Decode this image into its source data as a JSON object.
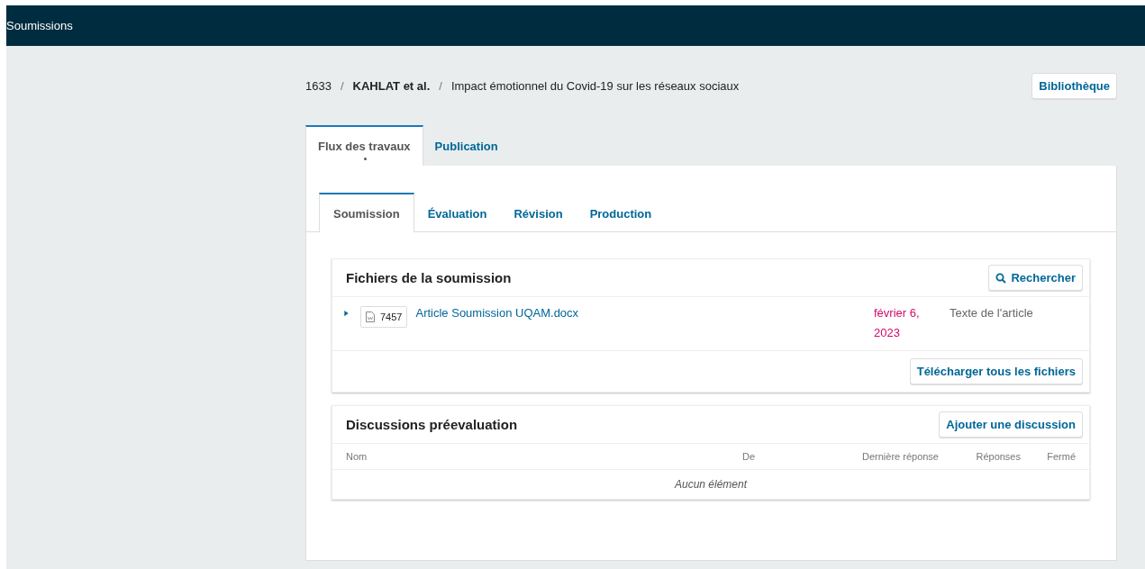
{
  "header": {
    "title": "Soumissions"
  },
  "breadcrumb": {
    "id": "1633",
    "authors": "KAHLAT et al.",
    "title": "Impact émotionnel du Covid-19 sur les réseaux sociaux",
    "separator": "/"
  },
  "library_button": "Bibliothèque",
  "main_tabs": [
    {
      "label": "Flux des travaux",
      "selected": true,
      "indicator": true
    },
    {
      "label": "Publication",
      "selected": false,
      "indicator": false
    }
  ],
  "stage_tabs": [
    {
      "label": "Soumission",
      "selected": true
    },
    {
      "label": "Évaluation",
      "selected": false
    },
    {
      "label": "Révision",
      "selected": false
    },
    {
      "label": "Production",
      "selected": false
    }
  ],
  "files_panel": {
    "title": "Fichiers de la soumission",
    "search_button": "Rechercher",
    "files": [
      {
        "id": "7457",
        "name": "Article Soumission UQAM.docx",
        "date": "février 6, 2023",
        "type": "Texte de l'article",
        "expanded": false
      }
    ],
    "download_button": "Télécharger tous les fichiers"
  },
  "discussions_panel": {
    "title": "Discussions préevaluation",
    "add_button": "Ajouter une discussion",
    "columns": [
      "Nom",
      "De",
      "Dernière réponse",
      "Réponses",
      "Fermé"
    ],
    "empty_message": "Aucun élément"
  }
}
